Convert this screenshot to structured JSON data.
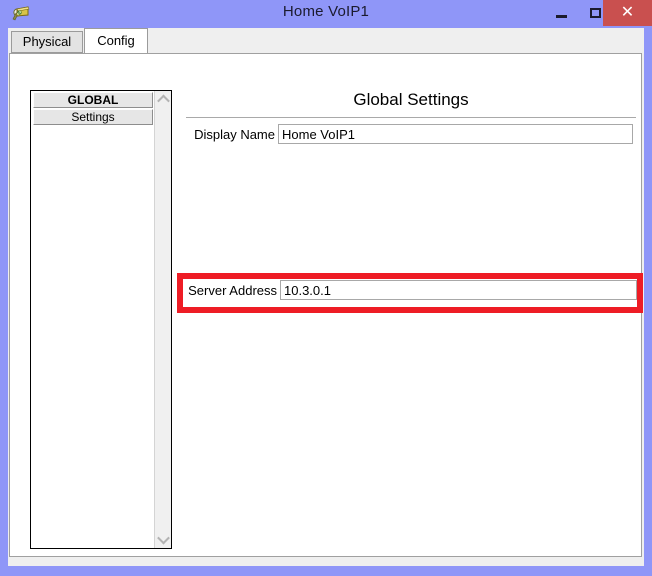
{
  "window": {
    "title": "Home VoIP1",
    "icon": "voip-device-icon",
    "controls": {
      "minimize": "minimize-icon",
      "maximize": "maximize-icon",
      "close": "✕"
    },
    "colors": {
      "title_bar": "#8f96f8",
      "close_button": "#c9504f",
      "highlight": "#ee1c25",
      "panel": "#ffffff",
      "frame": "#efefef"
    }
  },
  "tabs": [
    {
      "label": "Physical",
      "active": false
    },
    {
      "label": "Config",
      "active": true
    }
  ],
  "sidebar": {
    "items": [
      {
        "label": "GLOBAL",
        "bold": true
      },
      {
        "label": "Settings",
        "bold": false
      }
    ],
    "scrollbar": {
      "up_icon": "chevron-up-icon",
      "down_icon": "chevron-down-icon"
    }
  },
  "settings": {
    "title": "Global Settings",
    "fields": [
      {
        "label": "Display Name",
        "value": "Home VoIP1"
      },
      {
        "label": "Server Address",
        "value": "10.3.0.1",
        "highlighted": true
      }
    ]
  }
}
